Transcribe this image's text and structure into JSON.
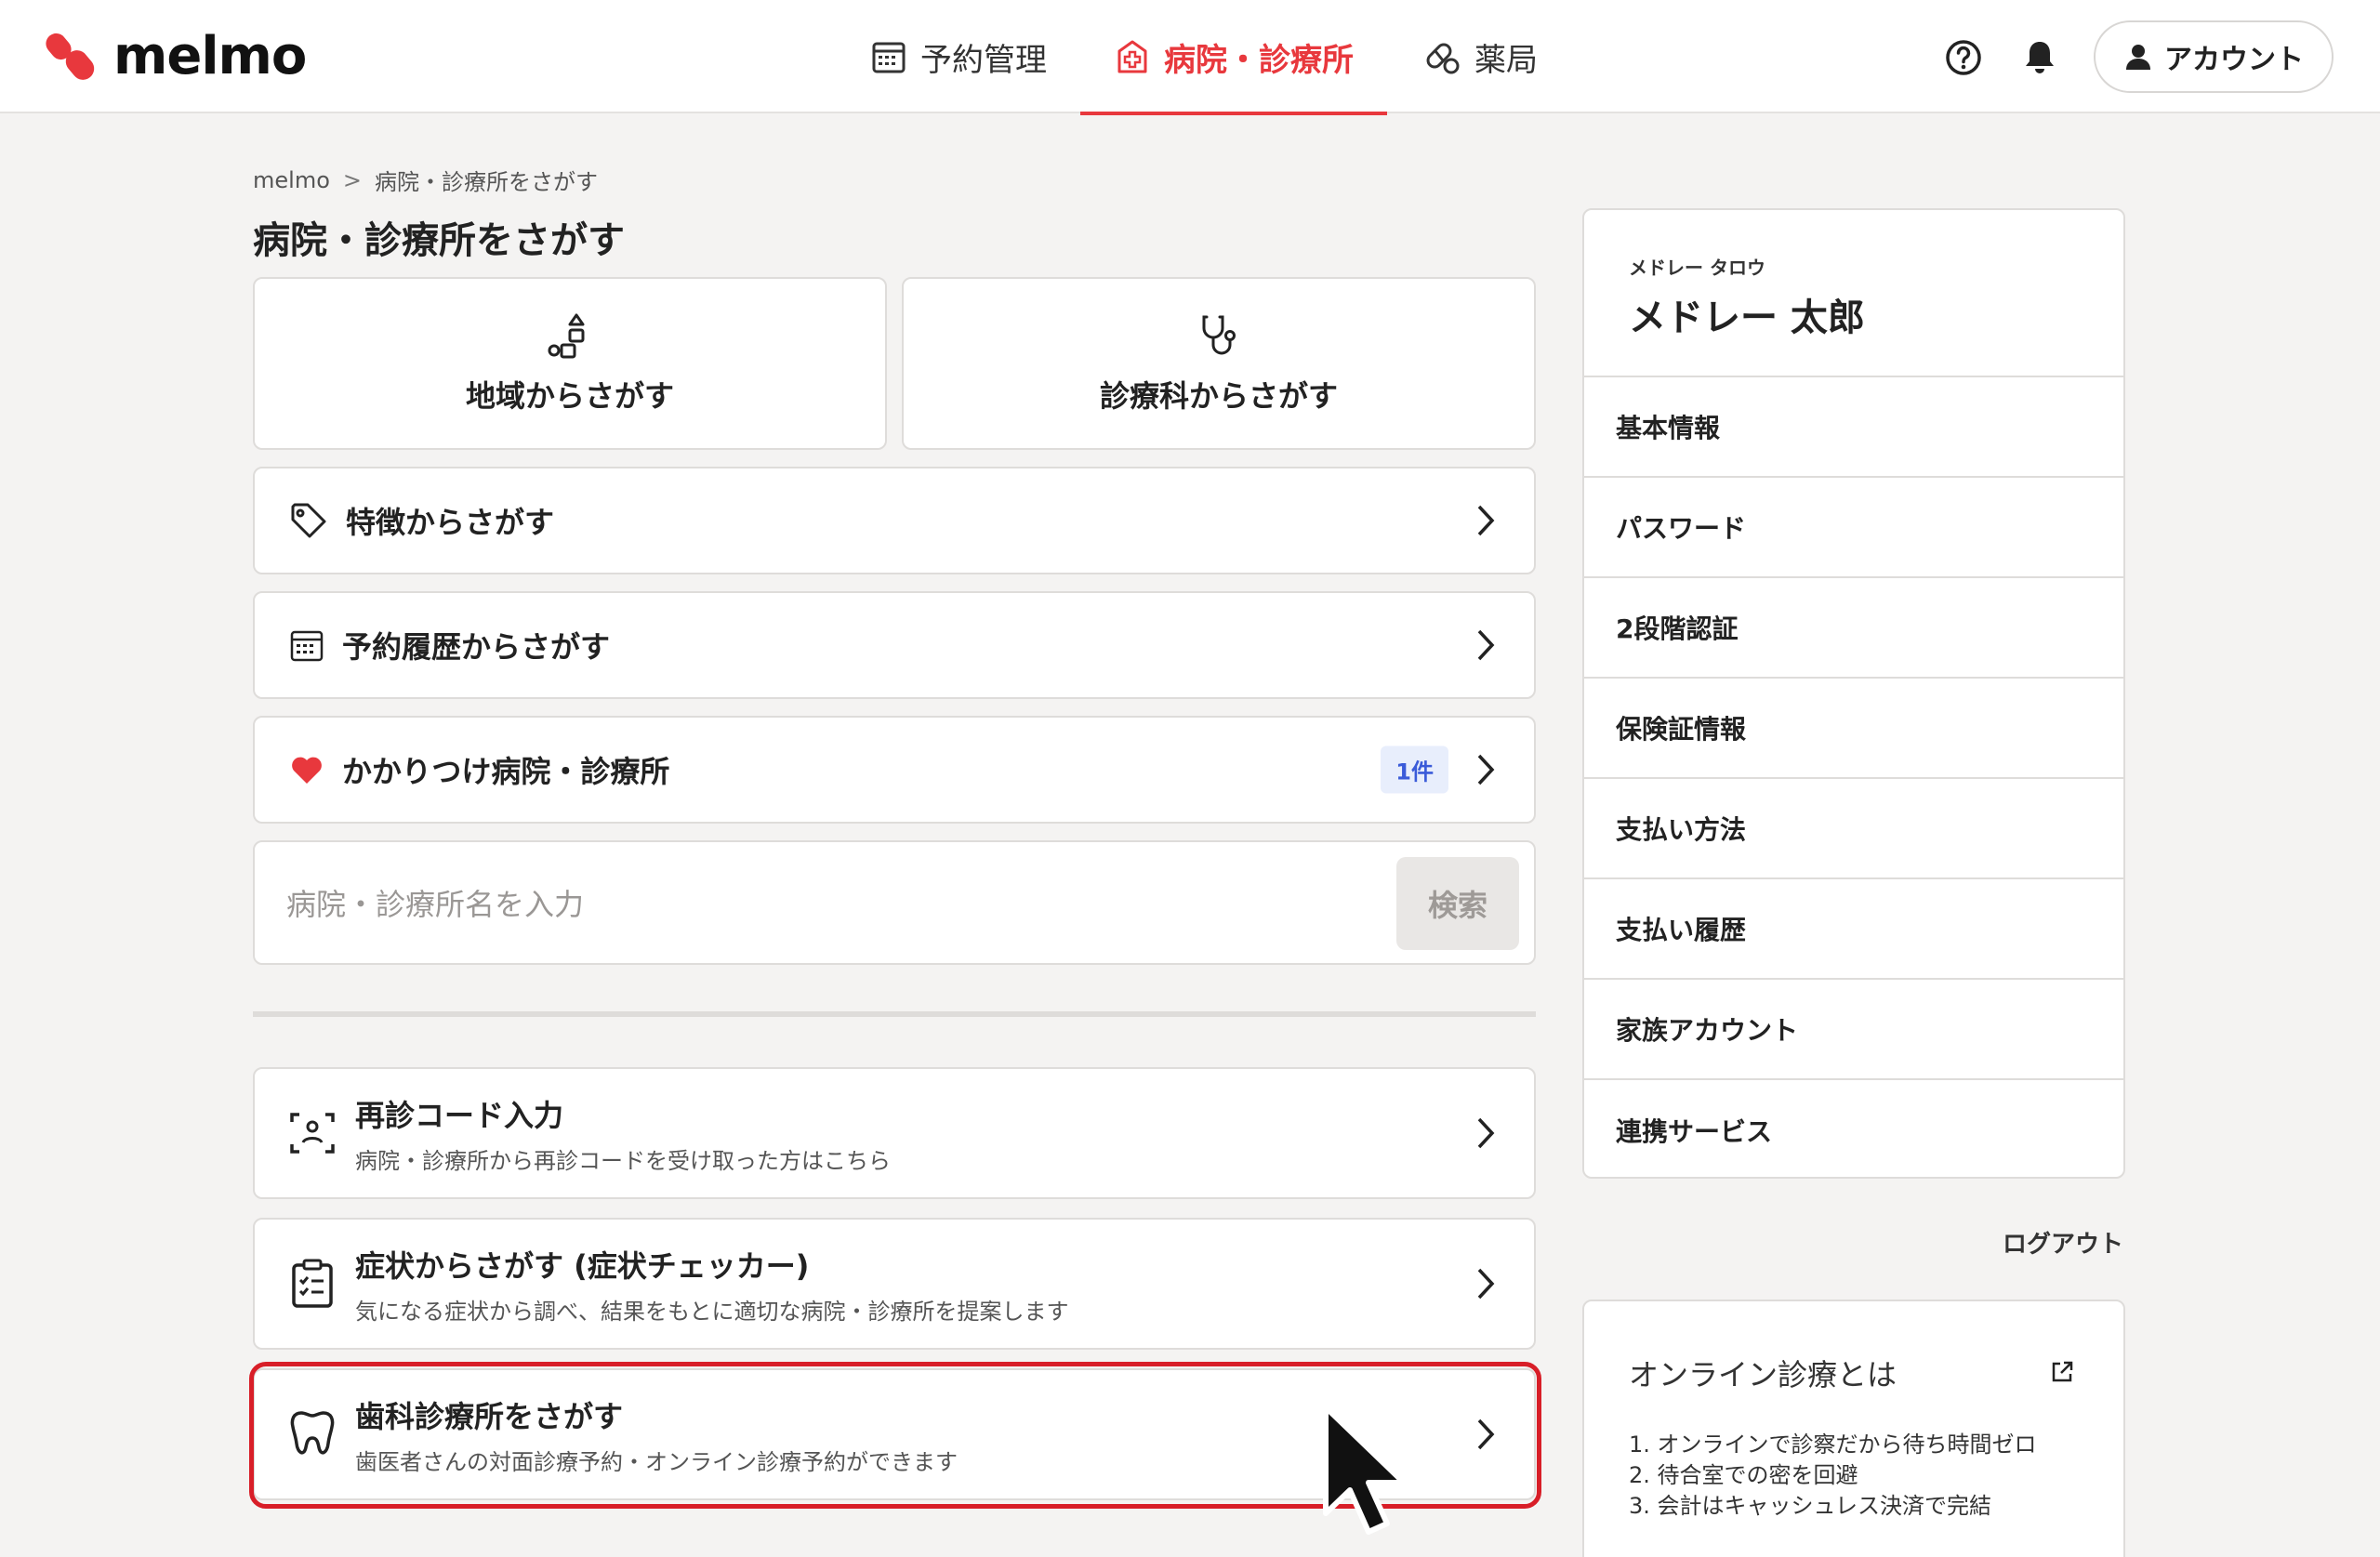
{
  "brand": {
    "name": "melmo",
    "accent": "#e8383d"
  },
  "nav": [
    {
      "label": "予約管理",
      "icon": "calendar-icon",
      "active": false
    },
    {
      "label": "病院・診療所",
      "icon": "hospital-icon",
      "active": true
    },
    {
      "label": "薬局",
      "icon": "pill-icon",
      "active": false
    }
  ],
  "header": {
    "account_label": "アカウント"
  },
  "breadcrumb": {
    "home": "melmo",
    "sep": ">",
    "current": "病院・診療所をさがす"
  },
  "page_title": "病院・診療所をさがす",
  "tiles": {
    "area": "地域からさがす",
    "department": "診療科からさがす"
  },
  "rows": {
    "features": "特徴からさがす",
    "history": "予約履歴からさがす",
    "favorite": "かかりつけ病院・診療所",
    "favorite_badge": "1件"
  },
  "search": {
    "placeholder": "病院・診療所名を入力",
    "button": "検索"
  },
  "links": [
    {
      "title": "再診コード入力",
      "sub": "病院・診療所から再診コードを受け取った方はこちら"
    },
    {
      "title": "症状からさがす (症状チェッカー)",
      "sub": "気になる症状から調べ、結果をもとに適切な病院・診療所を提案します"
    },
    {
      "title": "歯科診療所をさがす",
      "sub": "歯医者さんの対面診療予約・オンライン診療予約ができます"
    }
  ],
  "profile": {
    "kana": "メドレー タロウ",
    "name": "メドレー 太郎"
  },
  "menu": [
    "基本情報",
    "パスワード",
    "2段階認証",
    "保険証情報",
    "支払い方法",
    "支払い履歴",
    "家族アカウント",
    "連携サービス"
  ],
  "logout": "ログアウト",
  "info": {
    "title": "オンライン診療とは",
    "items": [
      "1. オンラインで診察だから待ち時間ゼロ",
      "2. 待合室での密を回避",
      "3. 会計はキャッシュレス決済で完結"
    ]
  }
}
